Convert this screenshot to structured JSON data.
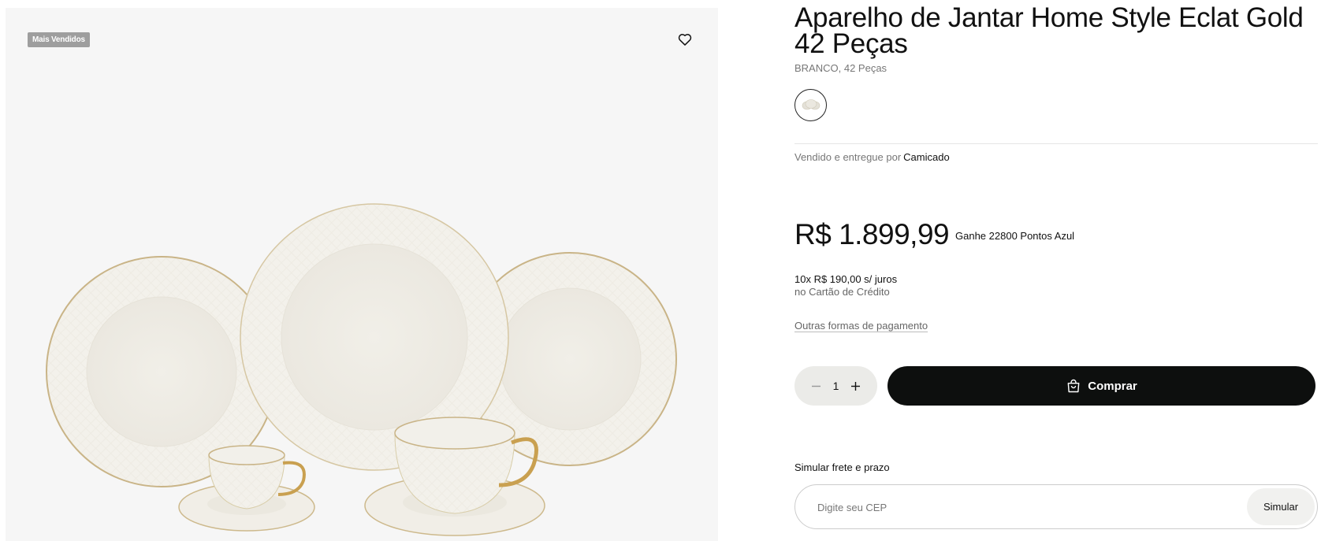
{
  "gallery": {
    "badge": "Mais Vendidos",
    "favorite_icon": "heart-icon"
  },
  "product": {
    "title": "Aparelho de Jantar Home Style Eclat Gold 42 Peças",
    "variant": "BRANCO, 42 Peças",
    "seller_prefix": "Vendido e entregue por",
    "seller_name": "Camicado"
  },
  "pricing": {
    "price": "R$ 1.899,99",
    "points": "Ganhe 22800 Pontos Azul",
    "installments": "10x R$ 190,00 s/ juros",
    "installments_note": "no Cartão de Crédito",
    "other_payments": "Outras formas de pagamento"
  },
  "purchase": {
    "quantity": "1",
    "buy_label": "Comprar",
    "minus_icon": "minus-icon",
    "plus_icon": "plus-icon",
    "bag_icon": "shopping-bag-icon"
  },
  "shipping": {
    "label": "Simular frete e prazo",
    "cep_placeholder": "Digite seu CEP",
    "button_label": "Simular"
  },
  "colors": {
    "buy_button": "#0d0f0e",
    "gallery_bg": "#f6f6f6",
    "badge_bg": "#9e9e9e"
  }
}
